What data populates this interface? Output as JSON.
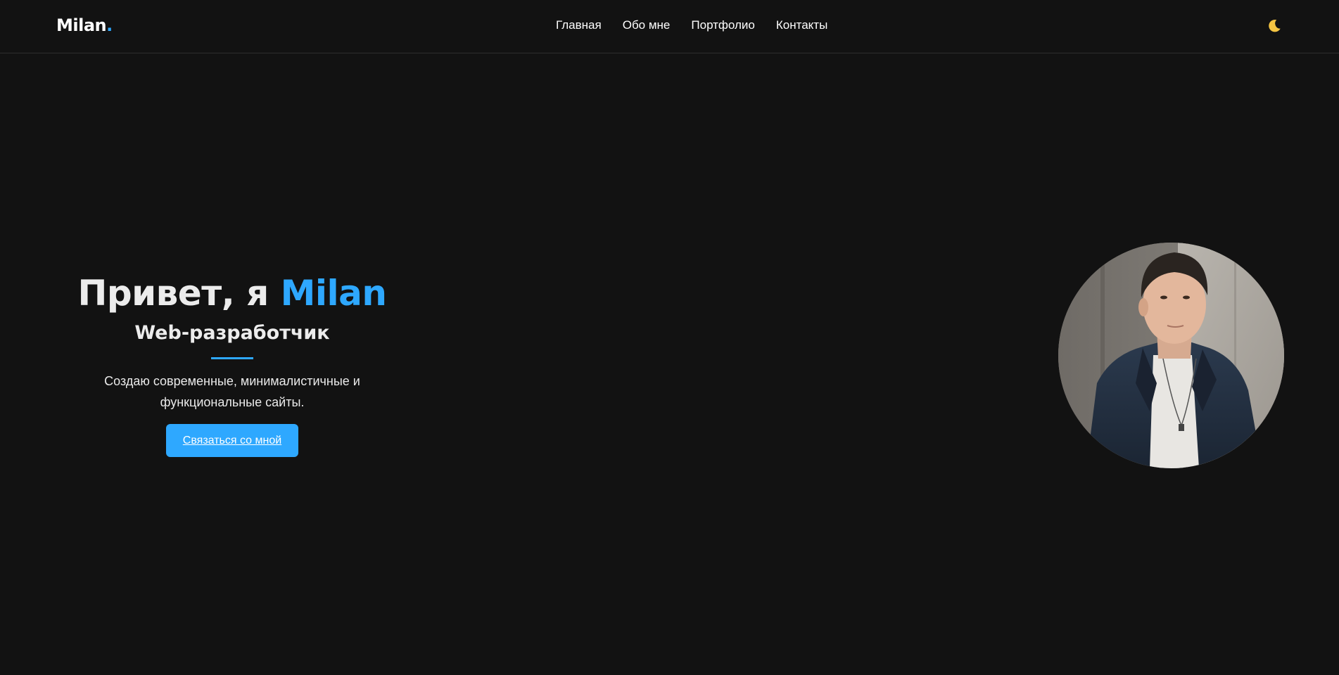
{
  "header": {
    "logo_text": "Milan",
    "logo_dot": ".",
    "nav": [
      {
        "label": "Главная"
      },
      {
        "label": "Обо мне"
      },
      {
        "label": "Портфолио"
      },
      {
        "label": "Контакты"
      }
    ],
    "theme_icon": "moon-icon"
  },
  "hero": {
    "title_prefix": "Привет, я ",
    "title_name": "Milan",
    "subtitle": "Web-разработчик",
    "description_line1": "Создаю современные, минималистичные и",
    "description_line2": "функциональные сайты.",
    "cta_label": "Связаться со мной",
    "avatar": "profile-photo"
  },
  "colors": {
    "background": "#121212",
    "accent": "#2ea8ff",
    "text": "#ffffff"
  }
}
